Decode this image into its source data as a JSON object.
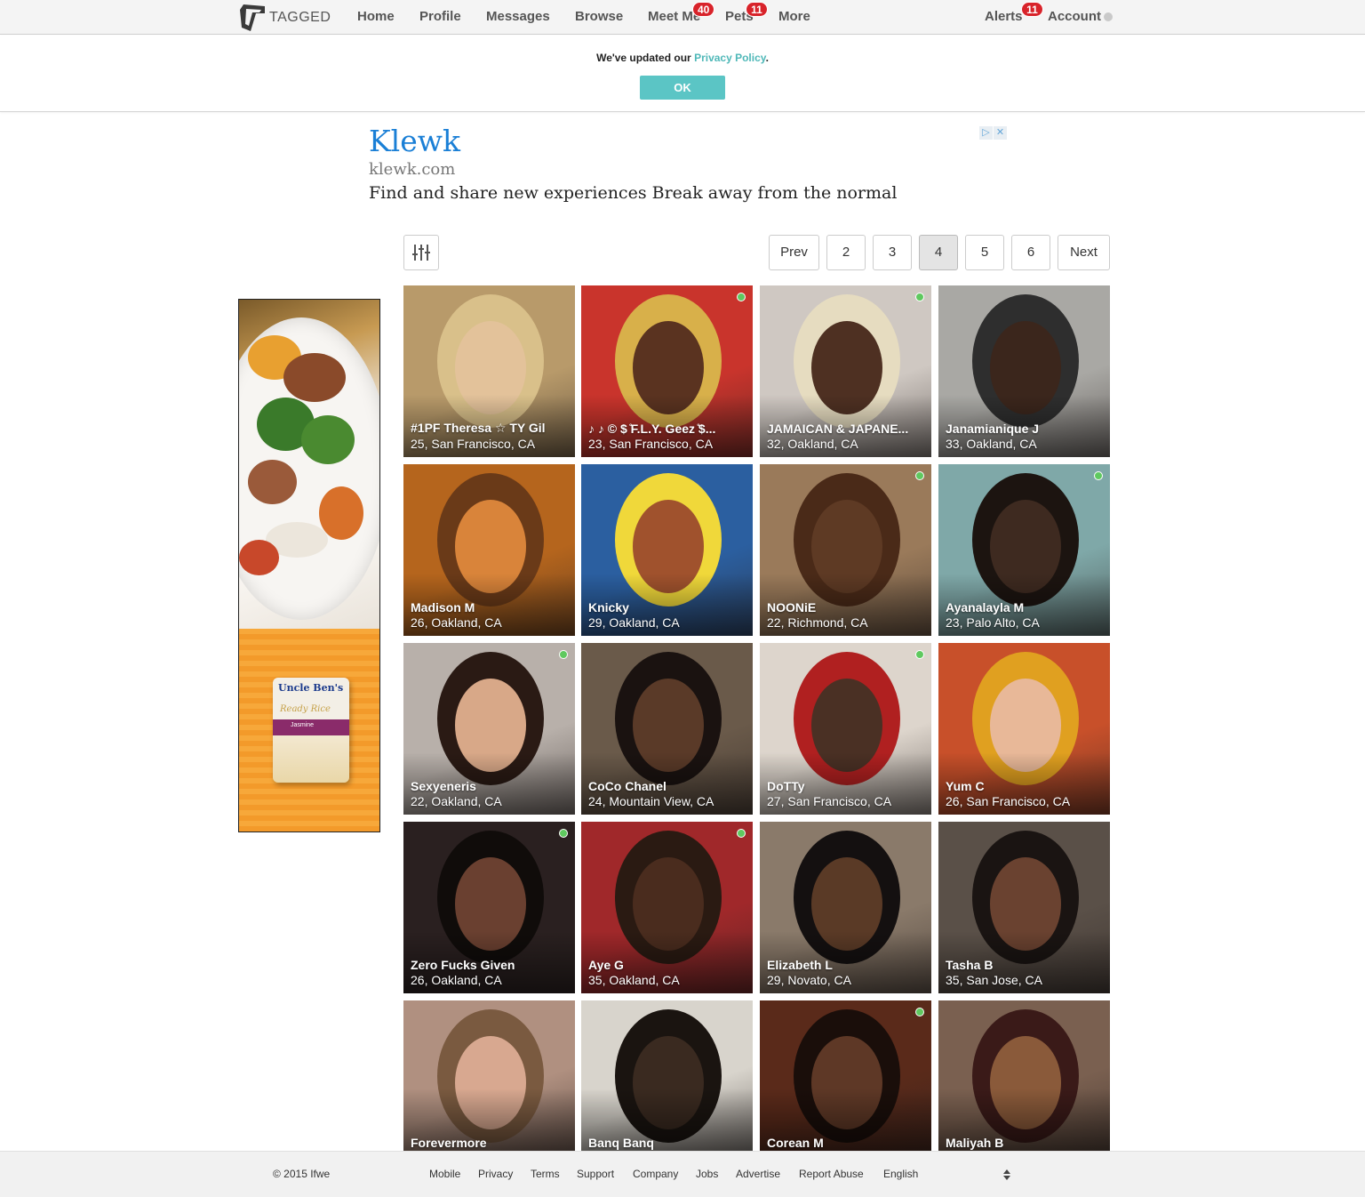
{
  "nav": {
    "logo_text": "TAGGED",
    "items": [
      "Home",
      "Profile",
      "Messages",
      "Browse",
      "Meet Me",
      "Pets",
      "More"
    ],
    "badges": {
      "meet_me": "40",
      "pets": "11",
      "alerts": "11"
    },
    "alerts": "Alerts",
    "account": "Account"
  },
  "privacy_banner": {
    "text_before": "We've updated our ",
    "link": "Privacy Policy",
    "text_after": ".",
    "ok": "OK"
  },
  "ad": {
    "title": "Klewk",
    "url": "klewk.com",
    "description": "Find and share new experiences Break away from the normal"
  },
  "side_ad": {
    "brand": "Uncle Ben's",
    "product": "Ready Rice",
    "variety": "Jasmine"
  },
  "pagination": {
    "prev": "Prev",
    "pages": [
      "2",
      "3",
      "4",
      "5",
      "6"
    ],
    "current": "4",
    "next": "Next"
  },
  "profiles": [
    {
      "name": "#1PF Theresa ☆ TY Gil",
      "location": "25, San Francisco, CA",
      "online": false,
      "bg": "#b89a6a",
      "skin": "#e3c29a",
      "hair": "#d9c08a"
    },
    {
      "name": "♪ ♪ © $ ̊F.L.Y. Geez ̊$...",
      "location": "23, San Francisco, CA",
      "online": true,
      "bg": "#c9342c",
      "skin": "#5a3320",
      "hair": "#d8b04a"
    },
    {
      "name": "JAMAICAN & JAPANE...",
      "location": "32, Oakland, CA",
      "online": true,
      "bg": "#cfc8c2",
      "skin": "#4e3022",
      "hair": "#e6dcc0"
    },
    {
      "name": "Janamianique J",
      "location": "33, Oakland, CA",
      "online": false,
      "bg": "#a9a8a4",
      "skin": "#3b261c",
      "hair": "#2e2e2e"
    },
    {
      "name": "Madison M",
      "location": "26, Oakland, CA",
      "online": false,
      "bg": "#b5651d",
      "skin": "#d9843a",
      "hair": "#6a3a18"
    },
    {
      "name": "Knicky",
      "location": "29, Oakland, CA",
      "online": false,
      "bg": "#2b5fa0",
      "skin": "#a0522d",
      "hair": "#f0d83a"
    },
    {
      "name": "NOONiE",
      "location": "22, Richmond, CA",
      "online": true,
      "bg": "#9a7a5a",
      "skin": "#5e3a24",
      "hair": "#4a2a18"
    },
    {
      "name": "Ayanalayla M",
      "location": "23, Palo Alto, CA",
      "online": true,
      "bg": "#7fa8a8",
      "skin": "#3e2a20",
      "hair": "#1c1410"
    },
    {
      "name": "Sexyeneris",
      "location": "22, Oakland, CA",
      "online": true,
      "bg": "#b8b0aa",
      "skin": "#d8a888",
      "hair": "#2a1a14"
    },
    {
      "name": "CoCo Chanel",
      "location": "24, Mountain View, CA",
      "online": false,
      "bg": "#6a5a4a",
      "skin": "#5a3a28",
      "hair": "#1a1210"
    },
    {
      "name": "DoTTy",
      "location": "27, San Francisco, CA",
      "online": true,
      "bg": "#ddd5cc",
      "skin": "#4a3024",
      "hair": "#b02020"
    },
    {
      "name": "Yum C",
      "location": "26, San Francisco, CA",
      "online": false,
      "bg": "#c8502a",
      "skin": "#e8b898",
      "hair": "#e0a020"
    },
    {
      "name": "Zero Fucks Given",
      "location": "26, Oakland, CA",
      "online": true,
      "bg": "#2a2020",
      "skin": "#6a4030",
      "hair": "#100c0a"
    },
    {
      "name": "Aye G",
      "location": "35, Oakland, CA",
      "online": true,
      "bg": "#a0282a",
      "skin": "#4a2c1e",
      "hair": "#2a1a12"
    },
    {
      "name": "Elizabeth L",
      "location": "29, Novato, CA",
      "online": false,
      "bg": "#8a7a6a",
      "skin": "#5a3a26",
      "hair": "#141010"
    },
    {
      "name": "Tasha B",
      "location": "35, San Jose, CA",
      "online": false,
      "bg": "#5a5048",
      "skin": "#6a4230",
      "hair": "#1a1412"
    },
    {
      "name": "Forevermore",
      "location": "",
      "online": false,
      "bg": "#b09080",
      "skin": "#d8a890",
      "hair": "#7a5a40"
    },
    {
      "name": "Banq Banq",
      "location": "",
      "online": false,
      "bg": "#d8d4cc",
      "skin": "#3a2a20",
      "hair": "#1a1410"
    },
    {
      "name": "Corean M",
      "location": "",
      "online": true,
      "bg": "#5a2a1a",
      "skin": "#5e3826",
      "hair": "#1a0e0a"
    },
    {
      "name": "Maliyah B",
      "location": "",
      "online": false,
      "bg": "#7a6050",
      "skin": "#8a5a3a",
      "hair": "#3a1a18"
    }
  ],
  "footer": {
    "copyright": "© 2015 Ifwe",
    "links": [
      "Mobile",
      "Privacy",
      "Terms",
      "Support",
      "Company",
      "Jobs",
      "Advertise",
      "Report Abuse",
      "English"
    ]
  }
}
